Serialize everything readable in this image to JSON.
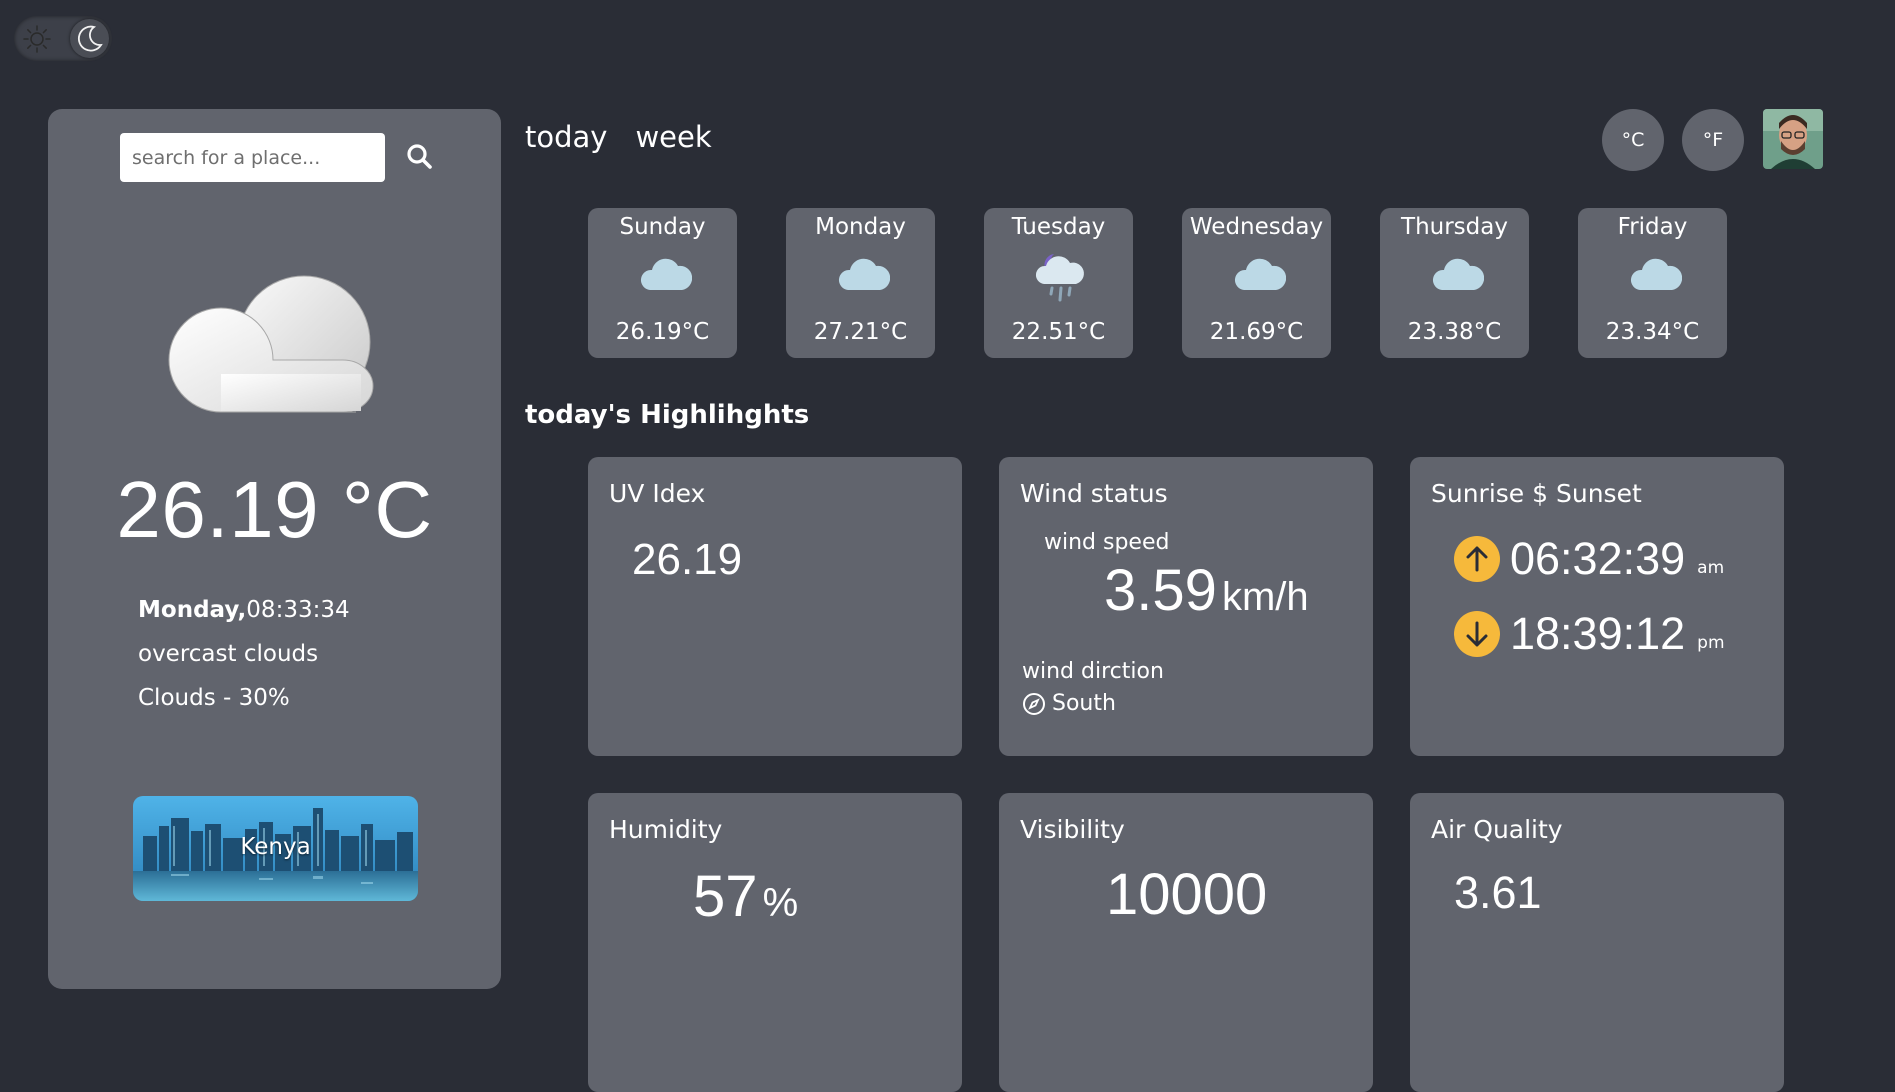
{
  "theme_toggle": {
    "mode": "dark"
  },
  "search": {
    "placeholder": "search for a place..."
  },
  "current": {
    "temperature": "26.19 °C",
    "day": "Monday,",
    "time": "08:33:34",
    "description": "overcast clouds",
    "clouds": "Clouds - 30%",
    "location": "Kenya"
  },
  "tabs": [
    "today",
    "week"
  ],
  "units": {
    "celsius": "°C",
    "fahrenheit": "°F"
  },
  "forecast": [
    {
      "day": "Sunday",
      "temp": "26.19°C",
      "icon": "cloud-icon"
    },
    {
      "day": "Monday",
      "temp": "27.21°C",
      "icon": "cloud-icon"
    },
    {
      "day": "Tuesday",
      "temp": "22.51°C",
      "icon": "night-rain-icon"
    },
    {
      "day": "Wednesday",
      "temp": "21.69°C",
      "icon": "cloud-icon"
    },
    {
      "day": "Thursday",
      "temp": "23.38°C",
      "icon": "cloud-icon"
    },
    {
      "day": "Friday",
      "temp": "23.34°C",
      "icon": "cloud-icon"
    }
  ],
  "highlights": {
    "title": "today's Highlihghts",
    "uv": {
      "title": "UV Idex",
      "value": "26.19"
    },
    "wind": {
      "title": "Wind status",
      "speed_label": "wind speed",
      "speed": "3.59",
      "speed_unit": "km/h",
      "direction_label": "wind dirction",
      "direction": "South"
    },
    "sun": {
      "title": "Sunrise $ Sunset",
      "sunrise": "06:32:39",
      "sunrise_suffix": "am",
      "sunset": "18:39:12",
      "sunset_suffix": "pm"
    },
    "humidity": {
      "title": "Humidity",
      "value": "57",
      "unit": "%"
    },
    "visibility": {
      "title": "Visibility",
      "value": "10000"
    },
    "air_quality": {
      "title": "Air Quality",
      "value": "3.61"
    }
  },
  "colors": {
    "background": "#2a2d36",
    "card": "#61646d",
    "accent": "#f6b93b"
  }
}
